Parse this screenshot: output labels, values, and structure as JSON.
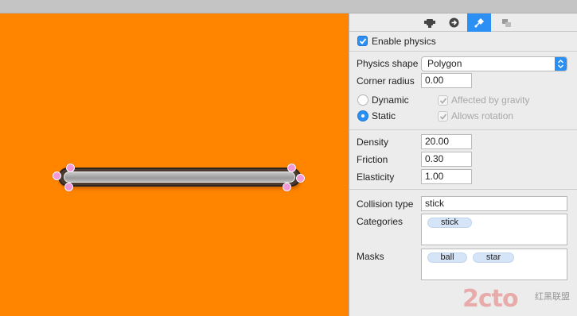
{
  "colors": {
    "canvas_background": "#ff8400",
    "accent": "#2c8ff3",
    "handle": "#f19ad7",
    "token": "#d6e4f7"
  },
  "toolbar": {
    "tabs": [
      {
        "icon": "node-icon",
        "active": false
      },
      {
        "icon": "arrow-right-circle-icon",
        "active": false
      },
      {
        "icon": "physics-pin-icon",
        "active": true
      },
      {
        "icon": "layers-icon",
        "active": false
      }
    ]
  },
  "physics": {
    "enable_label": "Enable physics",
    "enabled": true,
    "shape_label": "Physics shape",
    "shape_value": "Polygon",
    "corner_radius_label": "Corner radius",
    "corner_radius_value": "0.00",
    "dynamic_label": "Dynamic",
    "static_label": "Static",
    "body_type": "static",
    "affected_by_gravity_label": "Affected by gravity",
    "allows_rotation_label": "Allows rotation",
    "density_label": "Density",
    "density_value": "20.00",
    "friction_label": "Friction",
    "friction_value": "0.30",
    "elasticity_label": "Elasticity",
    "elasticity_value": "1.00",
    "collision_type_label": "Collision type",
    "collision_type_value": "stick",
    "categories_label": "Categories",
    "categories": [
      "stick"
    ],
    "masks_label": "Masks",
    "masks": [
      "ball",
      "star"
    ]
  },
  "watermark": {
    "main": "2cto",
    "side": "红黑联盟"
  }
}
